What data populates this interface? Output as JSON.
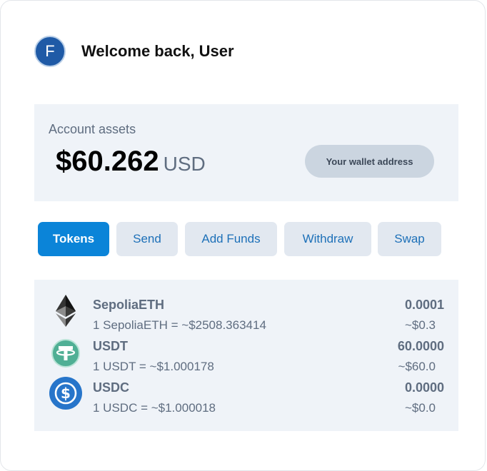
{
  "header": {
    "avatar_initial": "F",
    "welcome": "Welcome back, User"
  },
  "assets": {
    "label": "Account assets",
    "amount": "$60.262",
    "currency": "USD",
    "wallet_button": "Your wallet address"
  },
  "tabs": [
    {
      "label": "Tokens",
      "active": true
    },
    {
      "label": "Send",
      "active": false
    },
    {
      "label": "Add Funds",
      "active": false
    },
    {
      "label": "Withdraw",
      "active": false
    },
    {
      "label": "Swap",
      "active": false
    }
  ],
  "tokens": [
    {
      "name": "SepoliaETH",
      "rate": "1 SepoliaETH = ~$2508.363414",
      "quantity": "0.0001",
      "usd": "~$0.3",
      "icon": "ethereum-icon"
    },
    {
      "name": "USDT",
      "rate": "1 USDT = ~$1.000178",
      "quantity": "60.0000",
      "usd": "~$60.0",
      "icon": "tether-icon"
    },
    {
      "name": "USDC",
      "rate": "1 USDC = ~$1.000018",
      "quantity": "0.0000",
      "usd": "~$0.0",
      "icon": "usdc-icon"
    }
  ],
  "colors": {
    "accent": "#0b84d8",
    "tab_bg": "#e2e8f0",
    "panel_bg": "#eff3f8",
    "avatar_bg": "#1f5aa6",
    "tether": "#50af95",
    "usdc": "#2775ca"
  }
}
